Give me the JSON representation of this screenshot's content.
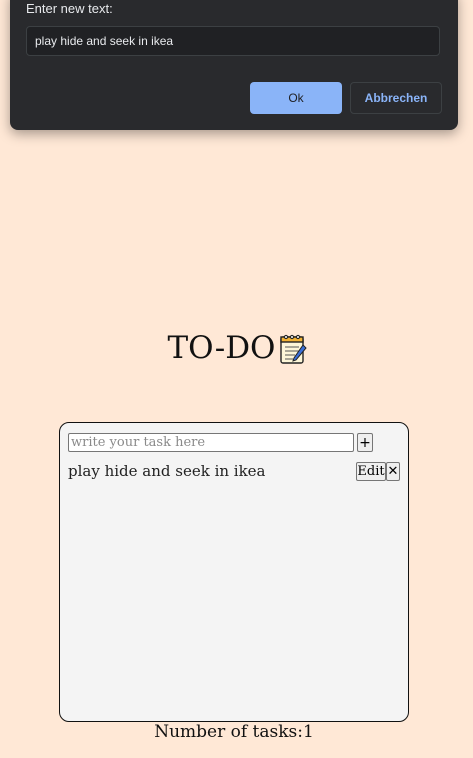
{
  "dialog": {
    "label": "Enter new text:",
    "input_value": "play hide and seek in ikea",
    "ok_label": "Ok",
    "cancel_label": "Abbrechen"
  },
  "app": {
    "title": "TO-DO",
    "title_icon": "notepad-icon"
  },
  "todo": {
    "input_placeholder": "write your task here",
    "add_label": "+",
    "tasks": [
      {
        "text": "play hide and seek in ikea",
        "edit_label": "Edit",
        "delete_label": "✕"
      }
    ]
  },
  "footer": {
    "count_text": "Number of tasks:1"
  }
}
